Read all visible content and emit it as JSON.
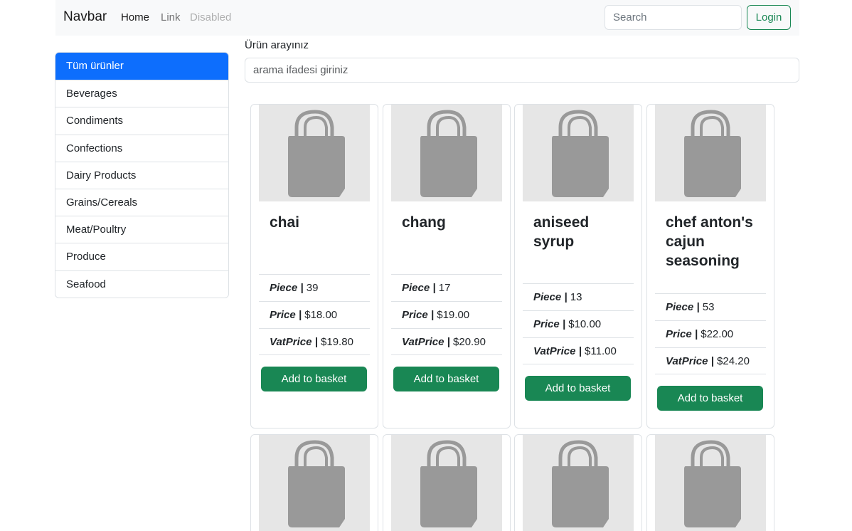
{
  "navbar": {
    "brand": "Navbar",
    "links": [
      "Home",
      "Link",
      "Disabled"
    ],
    "search_placeholder": "Search",
    "login_label": "Login"
  },
  "sidebar": {
    "items": [
      {
        "label": "Tüm ürünler",
        "active": true
      },
      {
        "label": "Beverages"
      },
      {
        "label": "Condiments"
      },
      {
        "label": "Confections"
      },
      {
        "label": "Dairy Products"
      },
      {
        "label": "Grains/Cereals"
      },
      {
        "label": "Meat/Poultry"
      },
      {
        "label": "Produce"
      },
      {
        "label": "Seafood"
      }
    ]
  },
  "search": {
    "label": "Ürün arayınız",
    "placeholder": "arama ifadesi giriniz"
  },
  "labels": {
    "piece": "Piece",
    "price": "Price",
    "vat": "VatPrice",
    "separator": " | ",
    "add_to_basket": "Add to basket"
  },
  "products": [
    {
      "name": "chai",
      "piece": "39",
      "price": "$18.00",
      "vat_price": "$19.80"
    },
    {
      "name": "chang",
      "piece": "17",
      "price": "$19.00",
      "vat_price": "$20.90"
    },
    {
      "name": "aniseed syrup",
      "piece": "13",
      "price": "$10.00",
      "vat_price": "$11.00"
    },
    {
      "name": "chef anton's cajun seasoning",
      "piece": "53",
      "price": "$22.00",
      "vat_price": "$24.20"
    }
  ],
  "colors": {
    "primary": "#0d6efd",
    "success": "#198754",
    "image_bg": "#e6e6e6",
    "bag_icon": "#999999"
  }
}
